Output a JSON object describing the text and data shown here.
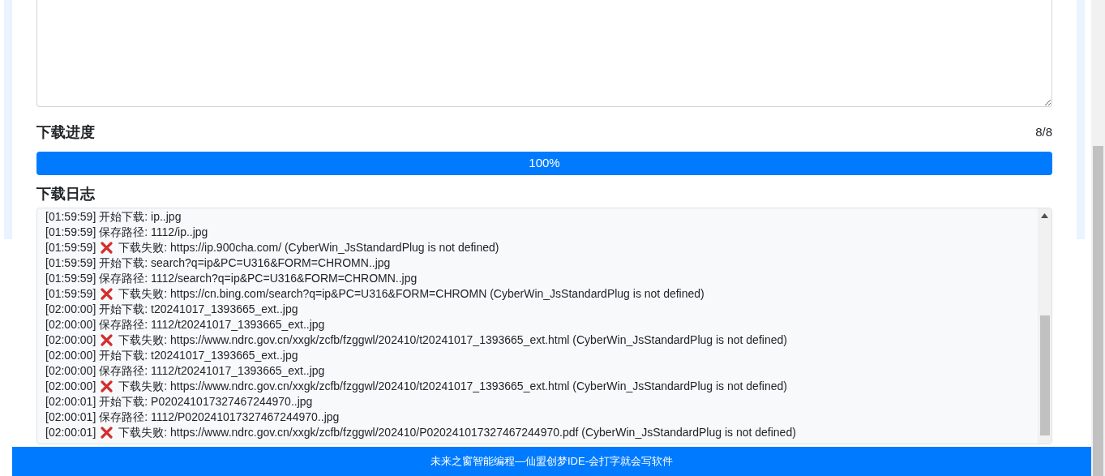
{
  "progress": {
    "title": "下载进度",
    "count": "8/8",
    "level": 1,
    "label": "100%"
  },
  "log": {
    "title": "下载日志",
    "lines": [
      {
        "time": "[01:59:59]",
        "kind": "info",
        "message": "开始下载: ip..jpg"
      },
      {
        "time": "[01:59:59]",
        "kind": "info",
        "message": "保存路径: 1112/ip..jpg"
      },
      {
        "time": "[01:59:59]",
        "kind": "error",
        "message": "下载失败: https://ip.900cha.com/ (CyberWin_JsStandardPlug is not defined)"
      },
      {
        "time": "[01:59:59]",
        "kind": "info",
        "message": "开始下载: search?q=ip&PC=U316&FORM=CHROMN..jpg"
      },
      {
        "time": "[01:59:59]",
        "kind": "info",
        "message": "保存路径: 1112/search?q=ip&PC=U316&FORM=CHROMN..jpg"
      },
      {
        "time": "[01:59:59]",
        "kind": "error",
        "message": "下载失败: https://cn.bing.com/search?q=ip&PC=U316&FORM=CHROMN (CyberWin_JsStandardPlug is not defined)"
      },
      {
        "time": "[02:00:00]",
        "kind": "info",
        "message": "开始下载: t20241017_1393665_ext..jpg"
      },
      {
        "time": "[02:00:00]",
        "kind": "info",
        "message": "保存路径: 1112/t20241017_1393665_ext..jpg"
      },
      {
        "time": "[02:00:00]",
        "kind": "error",
        "message": "下载失败: https://www.ndrc.gov.cn/xxgk/zcfb/fzggwl/202410/t20241017_1393665_ext.html (CyberWin_JsStandardPlug is not defined)"
      },
      {
        "time": "[02:00:00]",
        "kind": "info",
        "message": "开始下载: t20241017_1393665_ext..jpg"
      },
      {
        "time": "[02:00:00]",
        "kind": "info",
        "message": "保存路径: 1112/t20241017_1393665_ext..jpg"
      },
      {
        "time": "[02:00:00]",
        "kind": "error",
        "message": "下载失败: https://www.ndrc.gov.cn/xxgk/zcfb/fzggwl/202410/t20241017_1393665_ext.html (CyberWin_JsStandardPlug is not defined)"
      },
      {
        "time": "[02:00:01]",
        "kind": "info",
        "message": "开始下载: P020241017327467244970..jpg"
      },
      {
        "time": "[02:00:01]",
        "kind": "info",
        "message": "保存路径: 1112/P020241017327467244970..jpg"
      },
      {
        "time": "[02:00:01]",
        "kind": "error",
        "message": "下载失败: https://www.ndrc.gov.cn/xxgk/zcfb/fzggwl/202410/P020241017327467244970.pdf (CyberWin_JsStandardPlug is not defined)"
      }
    ]
  },
  "footer": {
    "text": "未来之窗智能编程—仙盟创梦IDE-会打字就会写软件"
  }
}
